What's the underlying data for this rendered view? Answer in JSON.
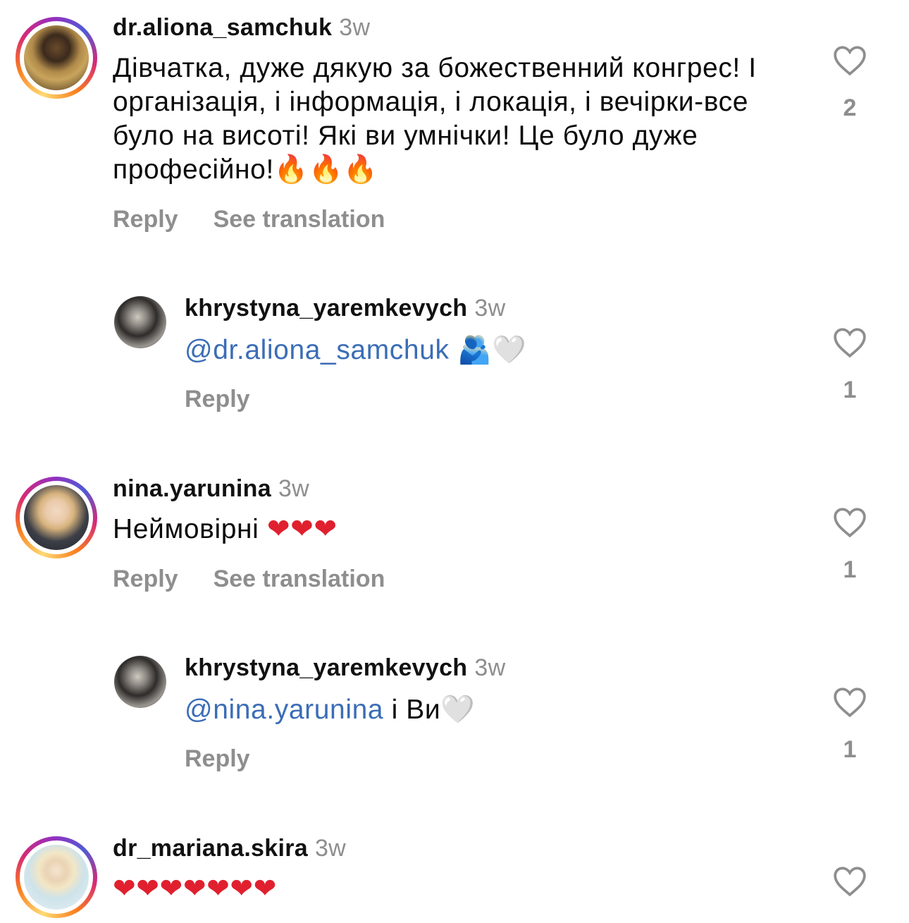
{
  "comments": [
    {
      "username": "dr.aliona_samchuk",
      "time": "3w",
      "text": "Дівчатка, дуже дякую за божественний конгрес! І організація, і інформація, і локація, і вечірки-все було на висоті! Які ви умнічки! Це було дуже професійно!",
      "emojis": "🔥🔥🔥",
      "reply_label": "Reply",
      "translate_label": "See translation",
      "likes": "2"
    },
    {
      "username": "khrystyna_yaremkevych",
      "time": "3w",
      "mention": "@dr.aliona_samchuk",
      "text": "",
      "emojis": "🫂🤍",
      "reply_label": "Reply",
      "likes": "1"
    },
    {
      "username": "nina.yarunina",
      "time": "3w",
      "text": "Неймовірні",
      "emojis": "❤❤❤",
      "reply_label": "Reply",
      "translate_label": "See translation",
      "likes": "1"
    },
    {
      "username": "khrystyna_yaremkevych",
      "time": "3w",
      "mention": "@nina.yarunina",
      "text": " і Ви",
      "emojis": "🤍",
      "reply_label": "Reply",
      "likes": "1"
    },
    {
      "username": "dr_mariana.skira",
      "time": "3w",
      "emojis": "❤❤❤❤❤❤❤",
      "likes": ""
    }
  ],
  "icons": {
    "like": "heart-outline-icon"
  },
  "colors": {
    "mention": "#3b6db6",
    "muted": "#8e8e8e",
    "heart_red": "#e0202e"
  }
}
